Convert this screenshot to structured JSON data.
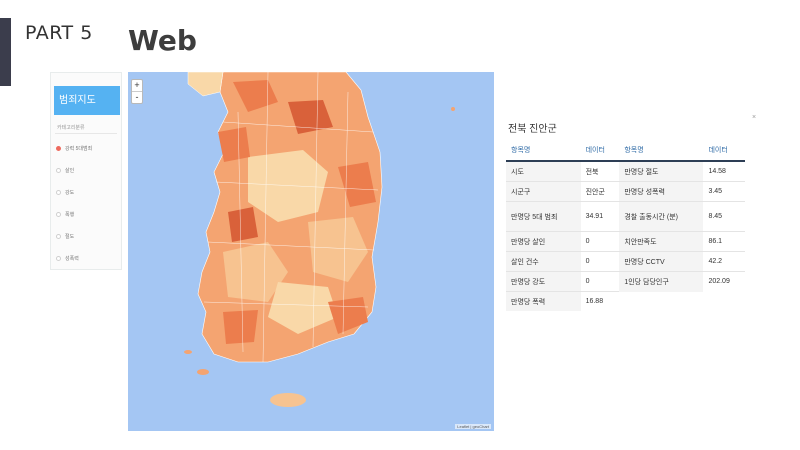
{
  "header": {
    "part": "PART  5",
    "title": "Web"
  },
  "sidebar": {
    "title": "범죄지도",
    "subtitle": "카테고리분류",
    "options": [
      {
        "label": "강력 5대범죄",
        "selected": true
      },
      {
        "label": "살인",
        "selected": false
      },
      {
        "label": "강도",
        "selected": false
      },
      {
        "label": "폭행",
        "selected": false
      },
      {
        "label": "절도",
        "selected": false
      },
      {
        "label": "성폭력",
        "selected": false
      }
    ]
  },
  "map": {
    "zoom_in": "+",
    "zoom_out": "-",
    "attribution": "Leaflet | geoChart",
    "colors": {
      "sea": "#a4c6f3",
      "light": "#f9d8a8",
      "mid": "#f4a471",
      "dark": "#ec7d4d",
      "darkest": "#d9613a"
    }
  },
  "info": {
    "title": "전북 진안군",
    "close": "×",
    "headers": [
      "항목명",
      "데이터",
      "항목명",
      "데이터"
    ],
    "rows": [
      [
        "시도",
        "전북",
        "만명당 절도",
        "14.58"
      ],
      [
        "시군구",
        "진안군",
        "만명당 성폭력",
        "3.45"
      ],
      [
        "만명당 5대 범죄",
        "34.91",
        "경찰 출동시간 (분)",
        "8.45"
      ],
      [
        "만명당 살인",
        "0",
        "치안만족도",
        "86.1"
      ],
      [
        "살인 건수",
        "0",
        "만명당 CCTV",
        "42.2"
      ],
      [
        "만명당 강도",
        "0",
        "1인당 담당인구",
        "202.09"
      ],
      [
        "만명당 폭력",
        "16.88",
        "",
        ""
      ]
    ]
  }
}
